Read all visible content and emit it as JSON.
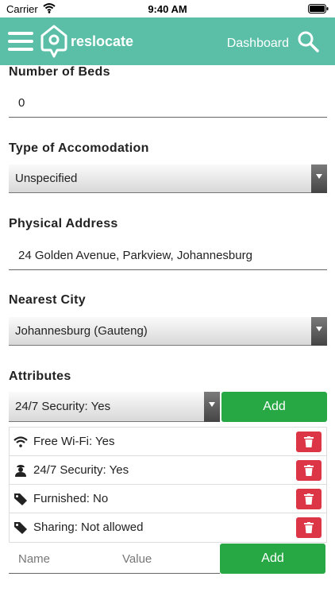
{
  "status_bar": {
    "carrier": "Carrier",
    "time": "9:40 AM"
  },
  "header": {
    "brand": "reslocate",
    "dashboard": "Dashboard"
  },
  "form": {
    "beds": {
      "label": "Number of Beds",
      "value": "0"
    },
    "accommodation": {
      "label": "Type of Accomodation",
      "value": "Unspecified"
    },
    "address": {
      "label": "Physical Address",
      "value": "24 Golden Avenue, Parkview, Johannesburg"
    },
    "city": {
      "label": "Nearest City",
      "value": "Johannesburg (Gauteng)"
    }
  },
  "attributes": {
    "label": "Attributes",
    "select_value": "24/7 Security: Yes",
    "add_label": "Add",
    "items": [
      {
        "icon": "wifi-icon",
        "text": "Free Wi-Fi: Yes"
      },
      {
        "icon": "security-guard-icon",
        "text": "24/7 Security: Yes"
      },
      {
        "icon": "tag-icon",
        "text": "Furnished: No"
      },
      {
        "icon": "tag-icon",
        "text": "Sharing: Not allowed"
      }
    ],
    "new_name_placeholder": "Name",
    "new_value_placeholder": "Value",
    "new_add_label": "Add"
  },
  "colors": {
    "header": "#5bbfa7",
    "add": "#28a745",
    "delete": "#dc3545"
  }
}
